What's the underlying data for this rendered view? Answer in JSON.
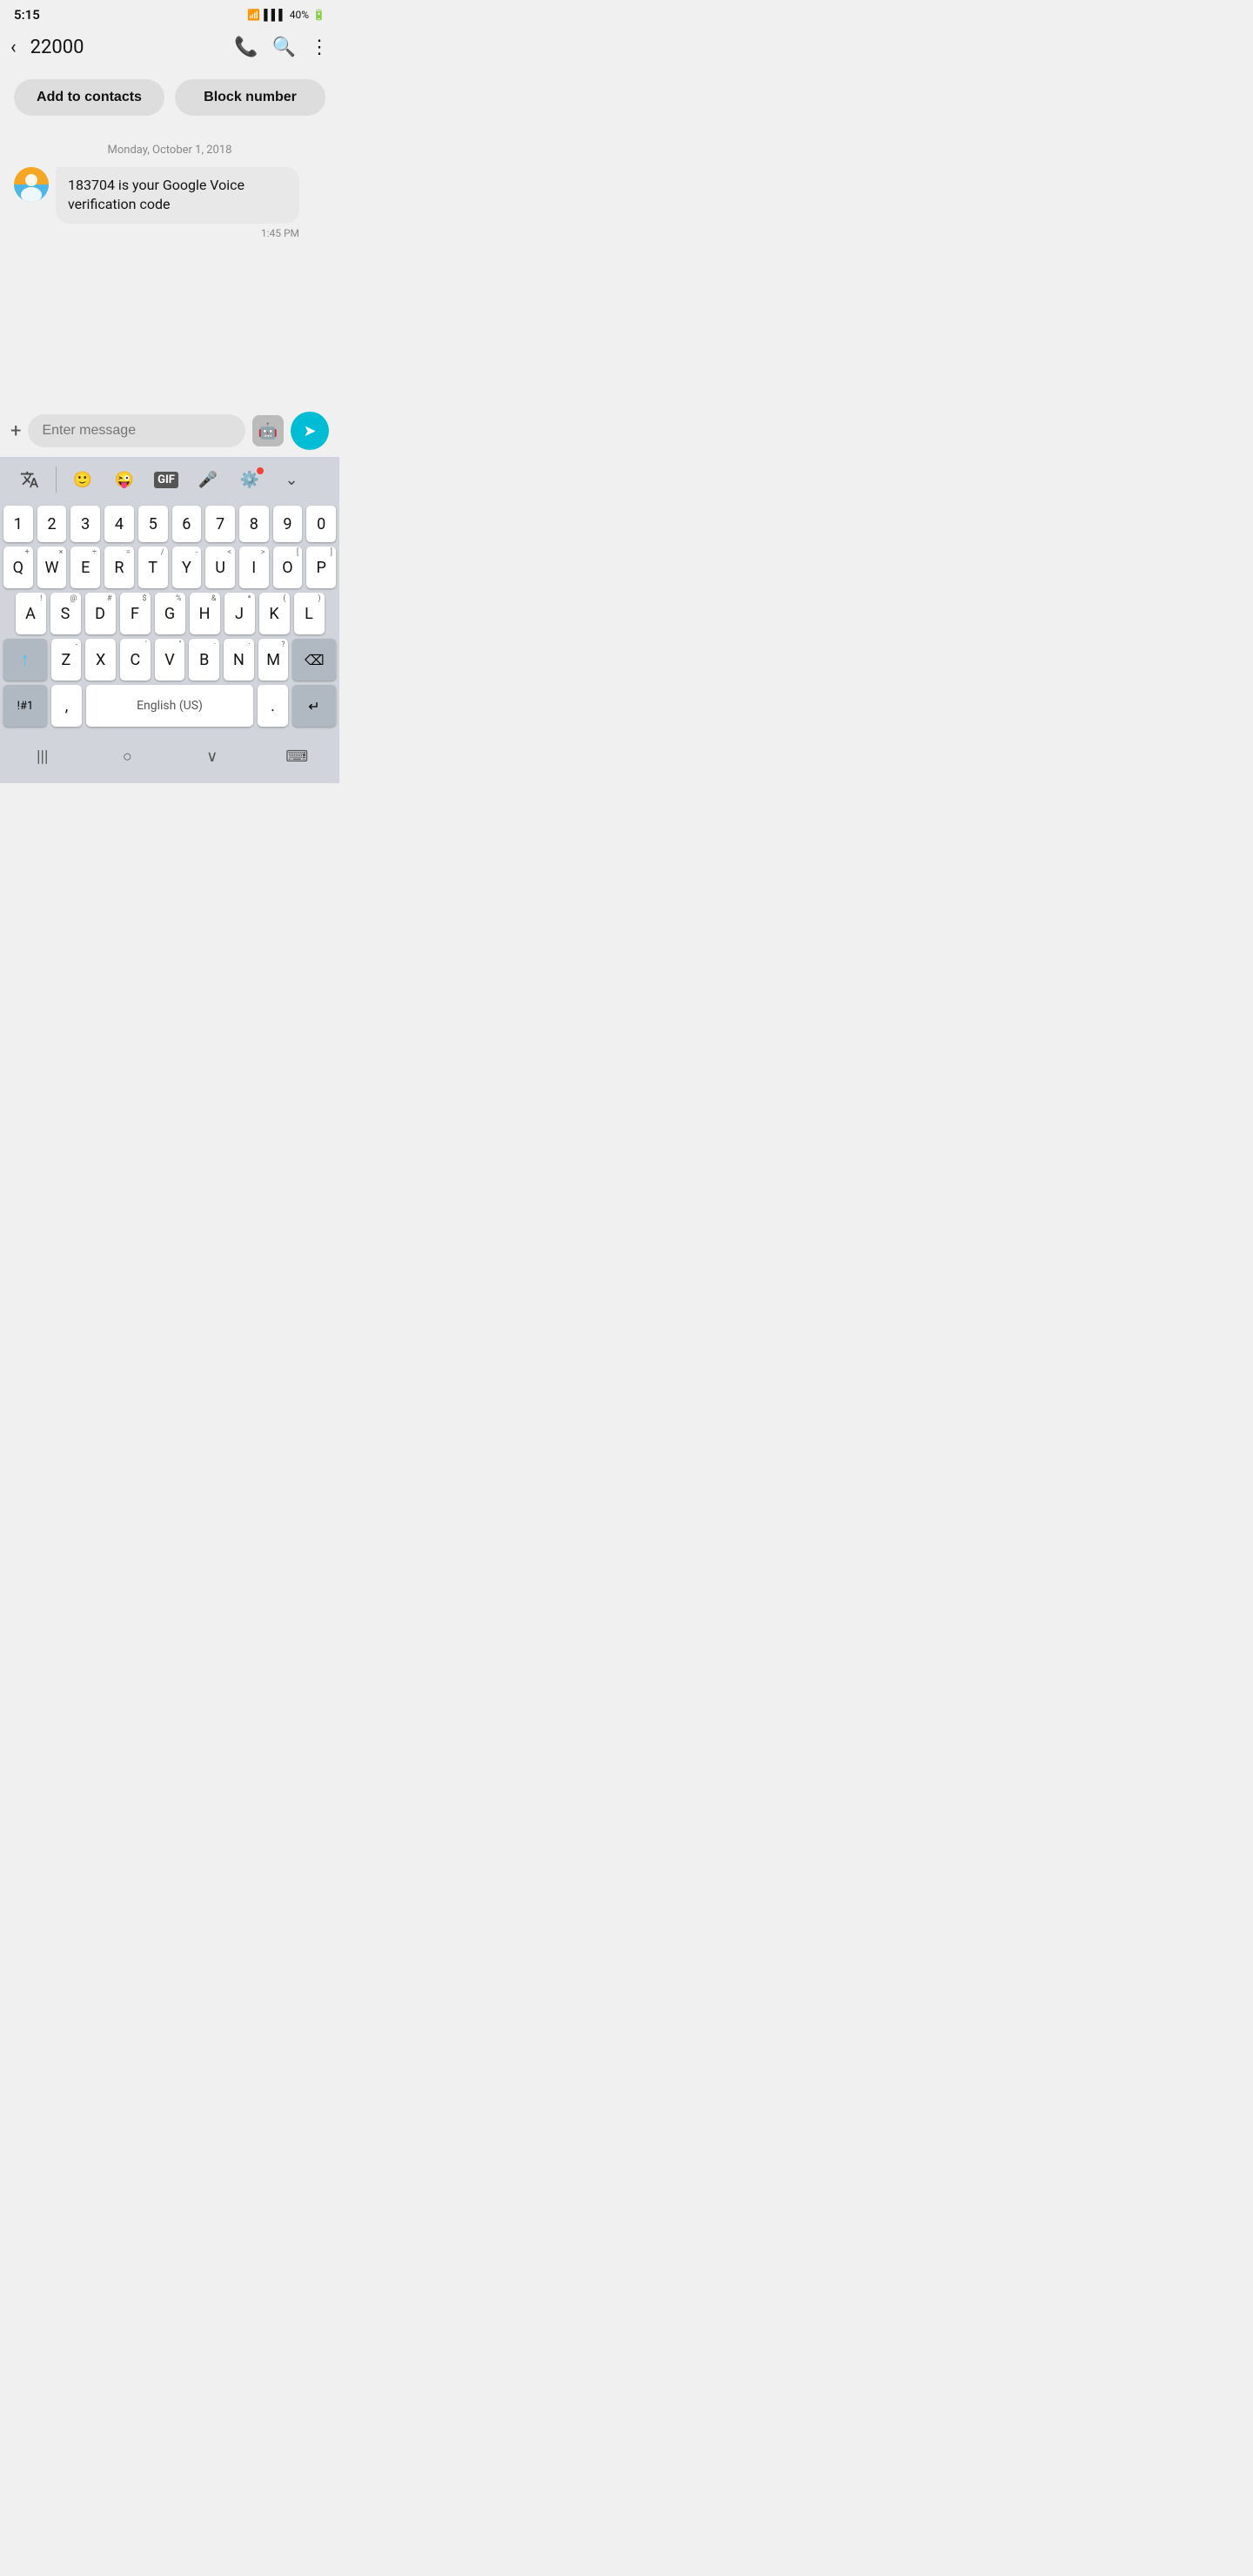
{
  "status_bar": {
    "time": "5:15",
    "battery": "40%"
  },
  "toolbar": {
    "back_label": "‹",
    "title": "22000",
    "call_icon": "phone",
    "search_icon": "search",
    "more_icon": "more"
  },
  "action_buttons": {
    "add_contacts_label": "Add to contacts",
    "block_number_label": "Block number"
  },
  "message_area": {
    "date_label": "Monday, October 1, 2018",
    "messages": [
      {
        "text": "183704 is your Google Voice verification code",
        "time": "1:45 PM",
        "sender": "them"
      }
    ]
  },
  "input": {
    "placeholder": "Enter message",
    "plus_icon": "+",
    "send_icon": "➤"
  },
  "keyboard": {
    "num_row": [
      "1",
      "2",
      "3",
      "4",
      "5",
      "6",
      "7",
      "8",
      "9",
      "0"
    ],
    "row1": [
      "Q",
      "W",
      "E",
      "R",
      "T",
      "Y",
      "U",
      "I",
      "O",
      "P"
    ],
    "row2": [
      "A",
      "S",
      "D",
      "F",
      "G",
      "H",
      "J",
      "K",
      "L"
    ],
    "row3": [
      "Z",
      "X",
      "C",
      "V",
      "B",
      "N",
      "M"
    ],
    "sub_row1": [
      "+",
      "×",
      "÷",
      "=",
      "/",
      "-",
      "<",
      ">",
      "[",
      "]"
    ],
    "sub_row2": [
      "!",
      "@",
      "#",
      "$",
      "%",
      "&",
      "*",
      "(",
      ")"
    ],
    "sub_row3": [
      "-",
      "'",
      "\"",
      "·",
      "·",
      "·",
      "?"
    ],
    "space_label": "English (US)",
    "sym_label": "!#1",
    "enter_label": "↵",
    "delete_label": "⌫",
    "shift_icon": "↑"
  },
  "nav_bar": {
    "menu_icon": "|||",
    "home_icon": "○",
    "back_icon": "∨",
    "keyboard_icon": "⌨"
  }
}
